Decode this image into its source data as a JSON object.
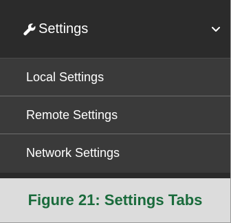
{
  "menu": {
    "header": {
      "icon": "wrench-icon",
      "label": "Settings",
      "toggle_icon": "chevron-down-icon"
    },
    "items": [
      {
        "label": "Local Settings"
      },
      {
        "label": "Remote Settings"
      },
      {
        "label": "Network Settings"
      }
    ]
  },
  "caption": {
    "text": "Figure 21: Settings Tabs"
  },
  "colors": {
    "menu_background": "#2b2b2b",
    "item_background": "#3a3a3a",
    "item_divider": "#6e6e6e",
    "caption_background": "#dcdcdc",
    "caption_text": "#1a6b3c"
  }
}
